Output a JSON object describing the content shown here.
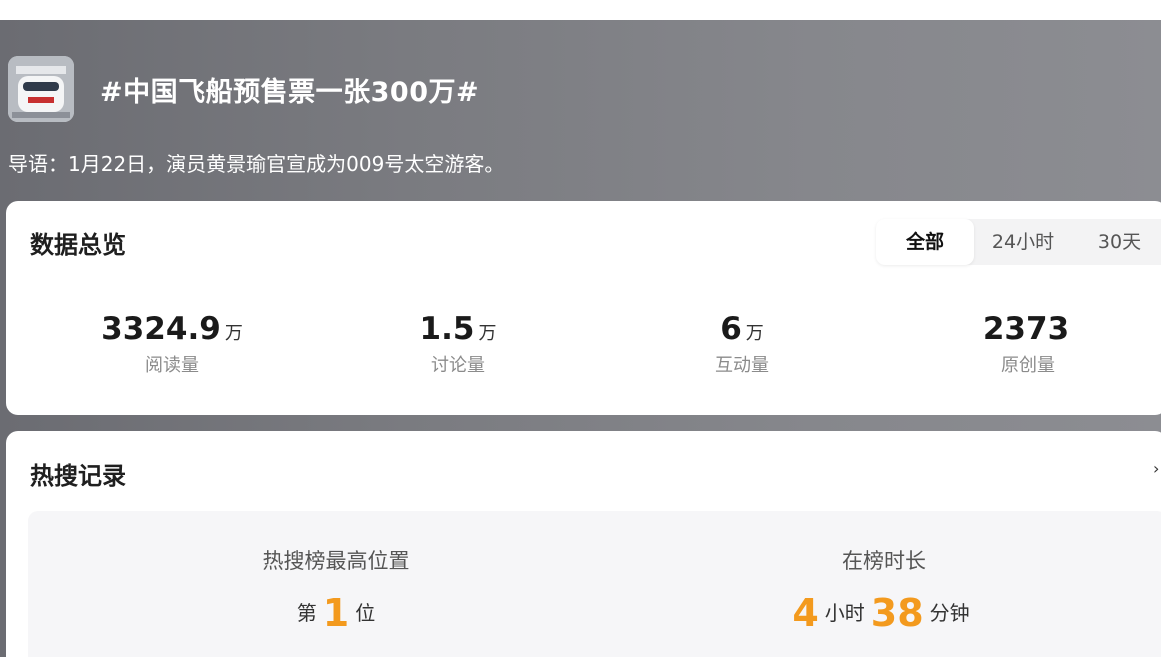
{
  "topic": {
    "title": "#中国飞船预售票一张300万#",
    "lead": "导语：1月22日，演员黄景瑜官宣成为009号太空游客。"
  },
  "overview": {
    "title": "数据总览",
    "tabs": [
      {
        "label": "全部",
        "active": true
      },
      {
        "label": "24小时",
        "active": false
      },
      {
        "label": "30天",
        "active": false
      }
    ],
    "stats": [
      {
        "value": "3324.9",
        "unit": "万",
        "label": "阅读量"
      },
      {
        "value": "1.5",
        "unit": "万",
        "label": "讨论量"
      },
      {
        "value": "6",
        "unit": "万",
        "label": "互动量"
      },
      {
        "value": "2373",
        "unit": "",
        "label": "原创量"
      }
    ]
  },
  "hot_search": {
    "title": "热搜记录",
    "highest_position": {
      "label": "热搜榜最高位置",
      "prefix": "第",
      "value": "1",
      "suffix": "位"
    },
    "duration": {
      "label": "在榜时长",
      "hours": "4",
      "hours_unit": "小时",
      "minutes": "38",
      "minutes_unit": "分钟"
    }
  },
  "colors": {
    "accent": "#f39a1e",
    "header_bg": "#7a7b80"
  }
}
